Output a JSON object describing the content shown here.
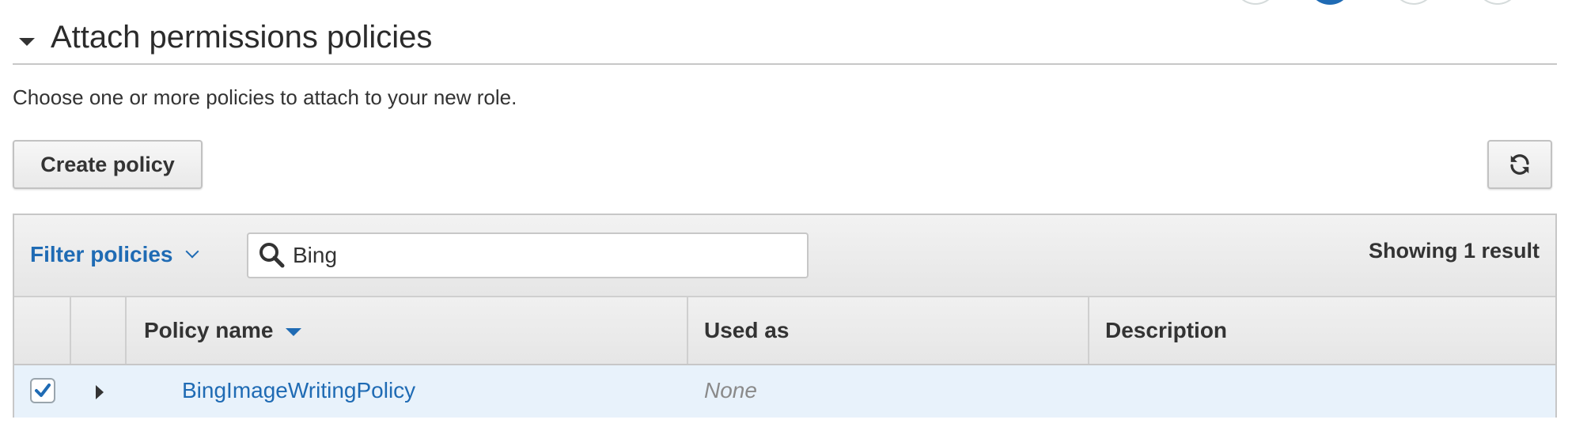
{
  "section": {
    "title": "Attach permissions policies",
    "intro": "Choose one or more policies to attach to your new role."
  },
  "toolbar": {
    "create_label": "Create policy",
    "refresh_icon": "refresh-icon"
  },
  "filter": {
    "label": "Filter policies",
    "search_value": "Bing",
    "result_count": "Showing 1 result"
  },
  "table": {
    "columns": [
      "Policy name",
      "Used as",
      "Description"
    ],
    "rows": [
      {
        "checked": true,
        "policy_name": "BingImageWritingPolicy",
        "used_as": "None",
        "description": ""
      }
    ]
  },
  "colors": {
    "accent": "#1f6bb4",
    "row_selected_bg": "#e8f2fb"
  }
}
